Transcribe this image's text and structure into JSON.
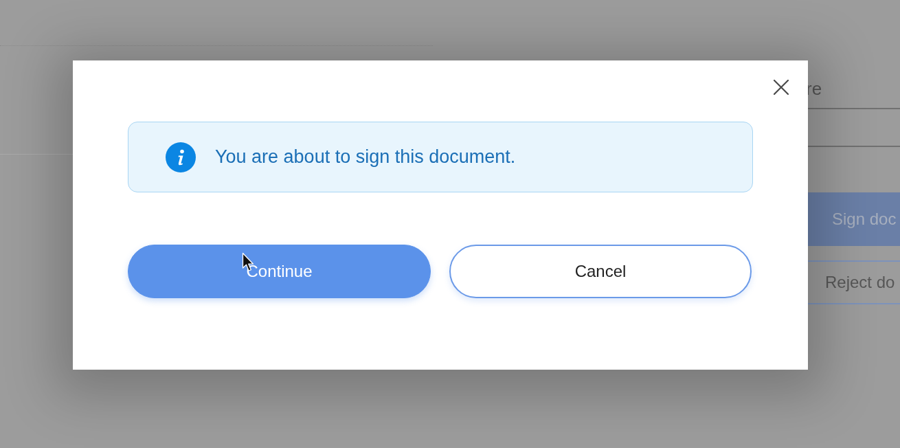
{
  "background": {
    "field_label": "re",
    "sign_button": {
      "label": "Sign doc"
    },
    "reject_button": {
      "label": "Reject do"
    }
  },
  "dialog": {
    "message": "You are about to sign this document.",
    "buttons": [
      {
        "label": "Continue",
        "kind": "primary"
      },
      {
        "label": "Cancel",
        "kind": "secondary"
      }
    ]
  }
}
